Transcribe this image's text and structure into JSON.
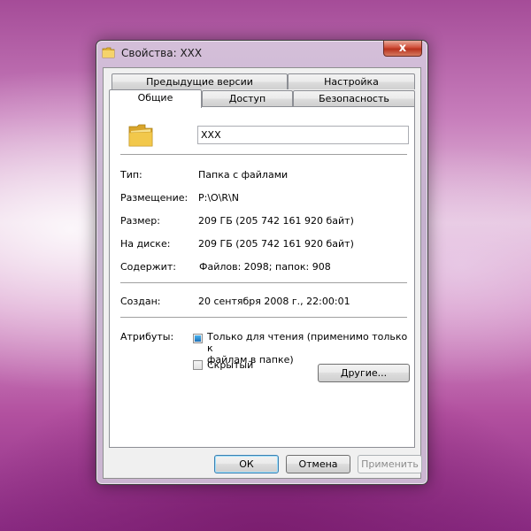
{
  "window": {
    "title": "Свойства: XXX",
    "close_glyph": "x"
  },
  "tabs": {
    "row_back": [
      "Предыдущие версии",
      "Настройка"
    ],
    "row_front": [
      "Общие",
      "Доступ",
      "Безопасность"
    ],
    "active": "Общие"
  },
  "general": {
    "name_value": "XXX",
    "rows": [
      {
        "label": "Тип:",
        "value": "Папка с файлами"
      },
      {
        "label": "Размещение:",
        "value": "P:\\O\\R\\N"
      },
      {
        "label": "Размер:",
        "value": "209 ГБ (205 742 161 920 байт)"
      },
      {
        "label": "На диске:",
        "value": "209 ГБ (205 742 161 920 байт)"
      },
      {
        "label": "Содержит:",
        "value": "Файлов: 2098; папок: 908"
      }
    ],
    "created_label": "Создан:",
    "created_value": "20 сентября 2008 г., 22:00:01",
    "attributes_label": "Атрибуты:",
    "readonly_label": "Только для чтения (применимо только к файлам в папке)",
    "readonly_line1": "Только для чтения (применимо только к",
    "readonly_line2": "файлам в папке)",
    "hidden_label": "Скрытый",
    "other_button": "Другие..."
  },
  "buttons": {
    "ok": "ОК",
    "cancel": "Отмена",
    "apply": "Применить"
  },
  "colors": {
    "folder_yellow": "#f2c84b",
    "accent_blue": "#1d6fb8",
    "close_red": "#c8402a"
  }
}
